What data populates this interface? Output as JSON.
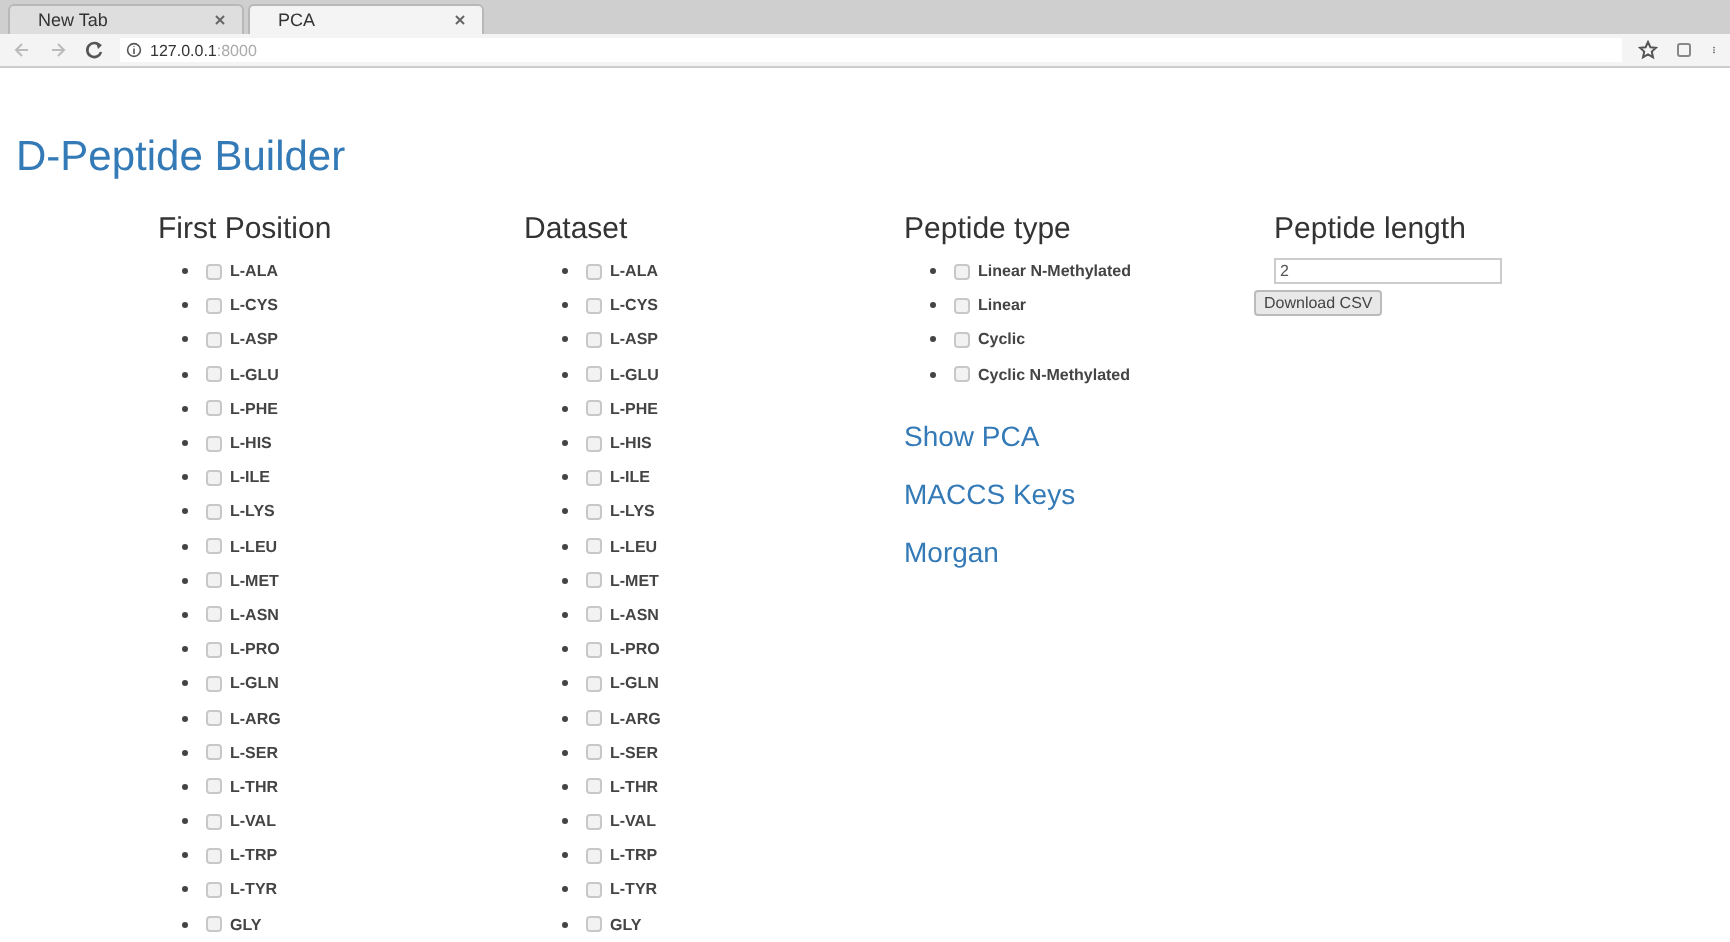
{
  "browser": {
    "tabs": [
      {
        "label": "New Tab",
        "selected": false
      },
      {
        "label": "PCA",
        "selected": true
      }
    ],
    "address": {
      "host": "127.0.0.1",
      "port": ":8000"
    }
  },
  "title": "D-Peptide Builder",
  "first_position": {
    "heading": "First Position",
    "items": [
      {
        "label": "L-ALA",
        "checked": false
      },
      {
        "label": "L-CYS",
        "checked": false
      },
      {
        "label": "L-ASP",
        "checked": false
      },
      {
        "label": "L-GLU",
        "checked": false
      },
      {
        "label": "L-PHE",
        "checked": false
      },
      {
        "label": "L-HIS",
        "checked": false
      },
      {
        "label": "L-ILE",
        "checked": false
      },
      {
        "label": "L-LYS",
        "checked": false
      },
      {
        "label": "L-LEU",
        "checked": false
      },
      {
        "label": "L-MET",
        "checked": false
      },
      {
        "label": "L-ASN",
        "checked": false
      },
      {
        "label": "L-PRO",
        "checked": false
      },
      {
        "label": "L-GLN",
        "checked": false
      },
      {
        "label": "L-ARG",
        "checked": false
      },
      {
        "label": "L-SER",
        "checked": false
      },
      {
        "label": "L-THR",
        "checked": false
      },
      {
        "label": "L-VAL",
        "checked": false
      },
      {
        "label": "L-TRP",
        "checked": false
      },
      {
        "label": "L-TYR",
        "checked": false
      },
      {
        "label": "GLY",
        "checked": false
      }
    ]
  },
  "dataset": {
    "heading": "Dataset",
    "items": [
      {
        "label": "L-ALA",
        "checked": false
      },
      {
        "label": "L-CYS",
        "checked": false
      },
      {
        "label": "L-ASP",
        "checked": false
      },
      {
        "label": "L-GLU",
        "checked": false
      },
      {
        "label": "L-PHE",
        "checked": false
      },
      {
        "label": "L-HIS",
        "checked": false
      },
      {
        "label": "L-ILE",
        "checked": false
      },
      {
        "label": "L-LYS",
        "checked": false
      },
      {
        "label": "L-LEU",
        "checked": false
      },
      {
        "label": "L-MET",
        "checked": false
      },
      {
        "label": "L-ASN",
        "checked": false
      },
      {
        "label": "L-PRO",
        "checked": false
      },
      {
        "label": "L-GLN",
        "checked": false
      },
      {
        "label": "L-ARG",
        "checked": false
      },
      {
        "label": "L-SER",
        "checked": false
      },
      {
        "label": "L-THR",
        "checked": false
      },
      {
        "label": "L-VAL",
        "checked": false
      },
      {
        "label": "L-TRP",
        "checked": false
      },
      {
        "label": "L-TYR",
        "checked": false
      },
      {
        "label": "GLY",
        "checked": false
      }
    ]
  },
  "peptide_type": {
    "heading": "Peptide type",
    "items": [
      {
        "label": "Linear N-Methylated",
        "checked": false
      },
      {
        "label": "Linear",
        "checked": false
      },
      {
        "label": "Cyclic",
        "checked": false
      },
      {
        "label": "Cyclic N-Methylated",
        "checked": false
      }
    ]
  },
  "links": [
    "Show PCA",
    "MACCS Keys",
    "Morgan"
  ],
  "peptide_length": {
    "heading": "Peptide length",
    "value": "2",
    "button": "Download CSV"
  }
}
